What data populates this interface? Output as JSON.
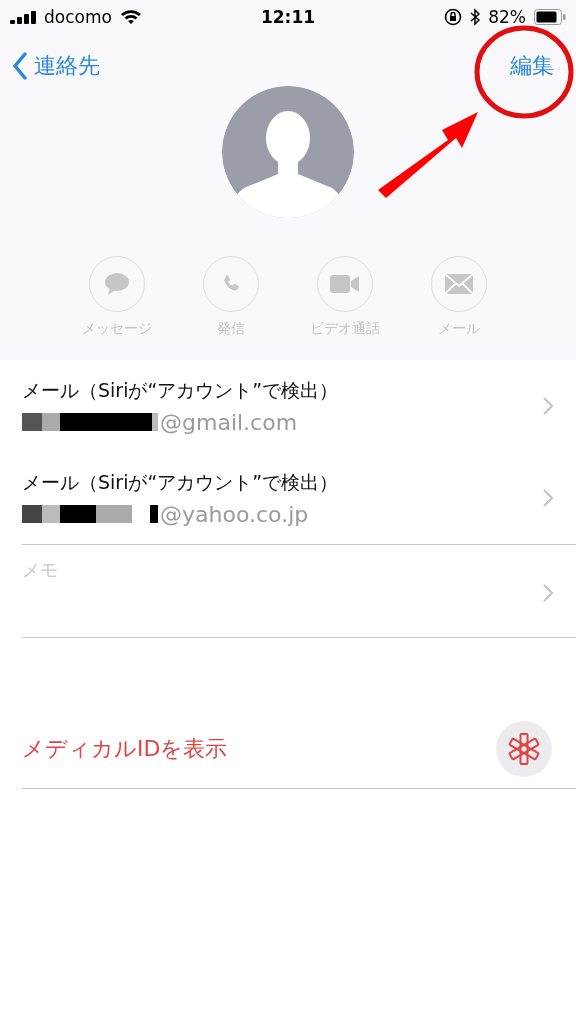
{
  "status_bar": {
    "carrier": "docomo",
    "time": "12:11",
    "battery": "82%"
  },
  "nav": {
    "back": "連絡先",
    "edit": "編集"
  },
  "actions": [
    {
      "kind": "message",
      "label": "メッセージ"
    },
    {
      "kind": "call",
      "label": "発信"
    },
    {
      "kind": "video",
      "label": "ビデオ通話"
    },
    {
      "kind": "mail",
      "label": "メール"
    }
  ],
  "fields": [
    {
      "label": "メール（Siriが“アカウント”で検出）",
      "value": "@gmail.com",
      "redacted": true
    },
    {
      "label": "メール（Siriが“アカウント”で検出）",
      "value": "@yahoo.co.jp",
      "redacted": true
    }
  ],
  "memo": {
    "placeholder": "メモ"
  },
  "medical_id": {
    "label": "メディカルIDを表示"
  },
  "annotation": {
    "kind": "circle-arrow"
  }
}
